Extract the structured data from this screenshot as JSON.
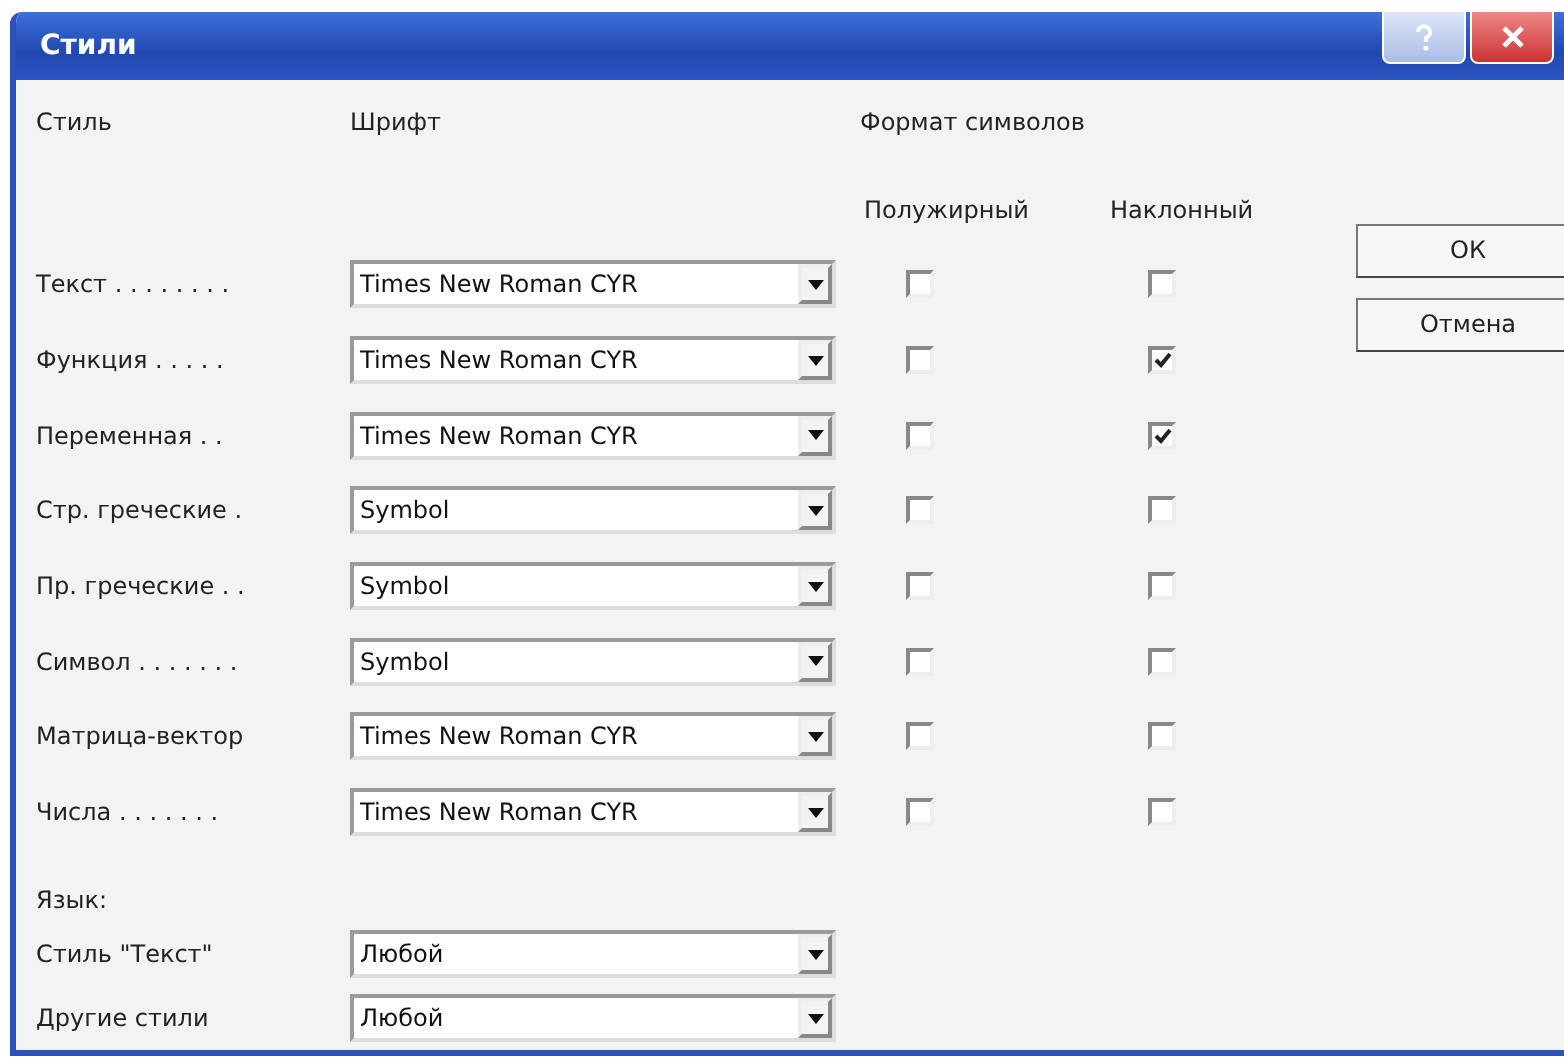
{
  "window": {
    "title": "Стили"
  },
  "headers": {
    "style": "Стиль",
    "font": "Шрифт",
    "format": "Формат символов",
    "bold": "Полужирный",
    "italic": "Наклонный"
  },
  "styles": [
    {
      "label": "Текст . . . . . . . .",
      "font": "Times New Roman CYR",
      "bold": false,
      "italic": false
    },
    {
      "label": "Функция . . . . .",
      "font": "Times New Roman CYR",
      "bold": false,
      "italic": true
    },
    {
      "label": "Переменная . .",
      "font": "Times New Roman CYR",
      "bold": false,
      "italic": true
    },
    {
      "label": "Стр. греческие .",
      "font": "Symbol",
      "bold": false,
      "italic": false
    },
    {
      "label": "Пр. греческие . .",
      "font": "Symbol",
      "bold": false,
      "italic": false
    },
    {
      "label": "Символ . . . . . . .",
      "font": "Symbol",
      "bold": false,
      "italic": false
    },
    {
      "label": "Матрица-вектор",
      "font": "Times New Roman CYR",
      "bold": false,
      "italic": false
    },
    {
      "label": "Числа . . . . . . .",
      "font": "Times New Roman CYR",
      "bold": false,
      "italic": false
    }
  ],
  "language": {
    "title": "Язык:",
    "rows": [
      {
        "label": "Стиль \"Текст\"",
        "value": "Любой"
      },
      {
        "label": "Другие стили",
        "value": "Любой"
      }
    ]
  },
  "buttons": [
    "ОК",
    "Отмена"
  ]
}
